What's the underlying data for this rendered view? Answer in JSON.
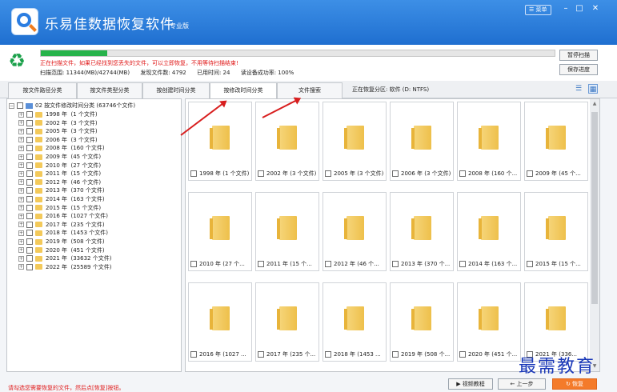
{
  "app": {
    "title": "乐易佳数据恢复软件",
    "edition": "专业版",
    "menu_label": "菜单"
  },
  "scan": {
    "progress": 0.13,
    "warning": "正在扫描文件，如果已经找到您丢失的文件，可以立即恢复，不用等待扫描结束!",
    "range": "扫描范围: 11344(MB)/42744(MB)",
    "found": "发现文件数: 4792",
    "elapsed": "已用时间: 24",
    "success": "读设备成功率: 100%",
    "pause_label": "暂停扫描",
    "save_label": "保存进度"
  },
  "tabs": [
    "按文件路径分类",
    "按文件类型分类",
    "按创建时间分类",
    "按修改时间分类",
    "文件搜索"
  ],
  "recovery_partition": "正在恢复分区: 软件 (D: NTFS)",
  "tree": {
    "root": "02 按文件修改时间分类 (63746个文件)",
    "items": [
      {
        "year": "1998 年",
        "count": "(1 个文件)"
      },
      {
        "year": "2002 年",
        "count": "(3 个文件)"
      },
      {
        "year": "2005 年",
        "count": "(3 个文件)"
      },
      {
        "year": "2006 年",
        "count": "(3 个文件)"
      },
      {
        "year": "2008 年",
        "count": "(160 个文件)"
      },
      {
        "year": "2009 年",
        "count": "(45 个文件)"
      },
      {
        "year": "2010 年",
        "count": "(27 个文件)"
      },
      {
        "year": "2011 年",
        "count": "(15 个文件)"
      },
      {
        "year": "2012 年",
        "count": "(46 个文件)"
      },
      {
        "year": "2013 年",
        "count": "(370 个文件)"
      },
      {
        "year": "2014 年",
        "count": "(163 个文件)"
      },
      {
        "year": "2015 年",
        "count": "(15 个文件)"
      },
      {
        "year": "2016 年",
        "count": "(1027 个文件)"
      },
      {
        "year": "2017 年",
        "count": "(235 个文件)"
      },
      {
        "year": "2018 年",
        "count": "(1453 个文件)"
      },
      {
        "year": "2019 年",
        "count": "(508 个文件)"
      },
      {
        "year": "2020 年",
        "count": "(451 个文件)"
      },
      {
        "year": "2021 年",
        "count": "(33632 个文件)"
      },
      {
        "year": "2022 年",
        "count": "(25589 个文件)"
      }
    ]
  },
  "grid": [
    "1998 年 (1 个文件)",
    "2002 年 (3 个文件)",
    "2005 年 (3 个文件)",
    "2006 年 (3 个文件)",
    "2008 年 (160 个...",
    "2009 年 (45 个...",
    "2010 年 (27 个...",
    "2011 年 (15 个...",
    "2012 年 (46 个...",
    "2013 年 (370 个...",
    "2014 年 (163 个...",
    "2015 年 (15 个...",
    "2016 年 (1027 ...",
    "2017 年 (235 个...",
    "2018 年 (1453 ...",
    "2019 年 (508 个...",
    "2020 年 (451 个...",
    "2021 年 (336..."
  ],
  "bottom": {
    "hint": "请勾选您需要恢复的文件，然后点[恢复]按钮。",
    "video_label": "视频教程",
    "prev_label": "上一步",
    "recover_label": "恢复"
  },
  "watermark": "最需教育"
}
